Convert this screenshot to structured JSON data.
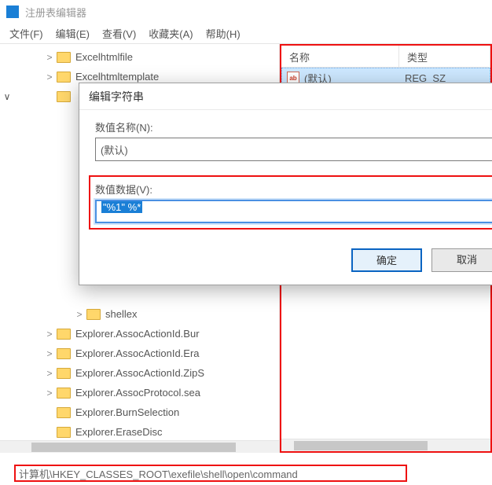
{
  "app": {
    "title": "注册表编辑器"
  },
  "menu": {
    "file": "文件(F)",
    "edit": "编辑(E)",
    "view": "查看(V)",
    "fav": "收藏夹(A)",
    "help": "帮助(H)"
  },
  "tree": {
    "items_top": [
      {
        "label": "Excelhtmlfile",
        "exp": ">"
      },
      {
        "label": "Excelhtmltemplate",
        "exp": ">"
      }
    ],
    "items_bottom": [
      {
        "label": "shellex",
        "exp": ">",
        "indent": true
      },
      {
        "label": "Explorer.AssocActionId.Bur",
        "exp": ">"
      },
      {
        "label": "Explorer.AssocActionId.Era",
        "exp": ">"
      },
      {
        "label": "Explorer.AssocActionId.ZipS",
        "exp": ">"
      },
      {
        "label": "Explorer.AssocProtocol.sea",
        "exp": ">"
      },
      {
        "label": "Explorer.BurnSelection",
        "exp": ""
      },
      {
        "label": "Explorer.EraseDisc",
        "exp": ""
      }
    ]
  },
  "list": {
    "headers": {
      "name": "名称",
      "type": "类型"
    },
    "rows": [
      {
        "name": "(默认)",
        "type": "REG_SZ",
        "icon": "ab"
      }
    ]
  },
  "dialog": {
    "title": "编辑字符串",
    "name_label": "数值名称(N):",
    "name_value": "(默认)",
    "data_label": "数值数据(V):",
    "data_value": "\"%1\" %*",
    "ok": "确定",
    "cancel": "取消"
  },
  "status": {
    "path": "计算机\\HKEY_CLASSES_ROOT\\exefile\\shell\\open\\command"
  }
}
